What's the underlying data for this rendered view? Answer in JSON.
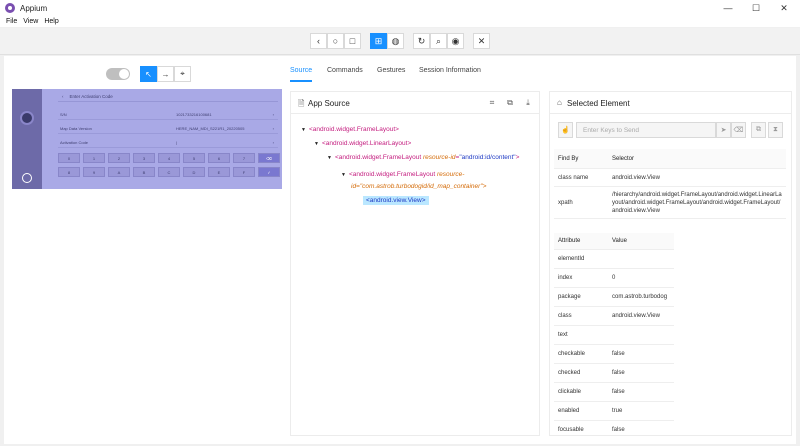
{
  "window": {
    "title": "Appium"
  },
  "menu": [
    "File",
    "View",
    "Help"
  ],
  "toolbar": {
    "buttons": [
      "back",
      "home",
      "recents",
      "select",
      "globe",
      "refresh",
      "search",
      "eye",
      "close"
    ]
  },
  "tabs": [
    "Source",
    "Commands",
    "Gestures",
    "Session Information"
  ],
  "device": {
    "header": "Enter Activation Code",
    "rows": [
      {
        "label": "S/N",
        "value": "1021733216100681"
      },
      {
        "label": "Map Data Version",
        "value": "HERE_NAM_MDI_S221R1_20220505"
      },
      {
        "label": "Activation Code",
        "value": "|"
      }
    ],
    "keys_row1": [
      "0",
      "1",
      "2",
      "3",
      "4",
      "5",
      "6",
      "7",
      "⌫"
    ],
    "keys_row2": [
      "8",
      "9",
      "A",
      "B",
      "C",
      "D",
      "E",
      "F",
      "✓"
    ]
  },
  "source": {
    "title": "App Source",
    "nodes": [
      {
        "tag": "<android.widget.FrameLayout>"
      },
      {
        "tag": "<android.widget.LinearLayout>"
      },
      {
        "tag": "<android.widget.FrameLayout",
        "attr": "resource-id",
        "val": "\"android:id/content\"",
        "end": ">"
      },
      {
        "tag": "<android.widget.FrameLayout",
        "attr": "resource-",
        "cont": "id=\"com.astrob.turbodogid/id_map_container\">"
      },
      {
        "tag": "<android.view.View>"
      }
    ]
  },
  "selected": {
    "title": "Selected Element",
    "keys_placeholder": "Enter Keys to Send",
    "find_header": [
      "Find By",
      "Selector"
    ],
    "find_rows": [
      {
        "k": "class name",
        "v": "android.view.View"
      },
      {
        "k": "xpath",
        "v": "/hierarchy/android.widget.FrameLayout/android.widget.LinearLayout/android.widget.FrameLayout/android.widget.FrameLayout/android.view.View"
      }
    ],
    "attr_header": [
      "Attribute",
      "Value"
    ],
    "attr_rows": [
      {
        "k": "elementId",
        "v": ""
      },
      {
        "k": "index",
        "v": "0"
      },
      {
        "k": "package",
        "v": "com.astrob.turbodog"
      },
      {
        "k": "class",
        "v": "android.view.View"
      },
      {
        "k": "text",
        "v": ""
      },
      {
        "k": "checkable",
        "v": "false"
      },
      {
        "k": "checked",
        "v": "false"
      },
      {
        "k": "clickable",
        "v": "false"
      },
      {
        "k": "enabled",
        "v": "true"
      },
      {
        "k": "focusable",
        "v": "false"
      }
    ]
  },
  "colors": {
    "accent": "#1890ff",
    "device_bg": "#a9a9e6"
  }
}
